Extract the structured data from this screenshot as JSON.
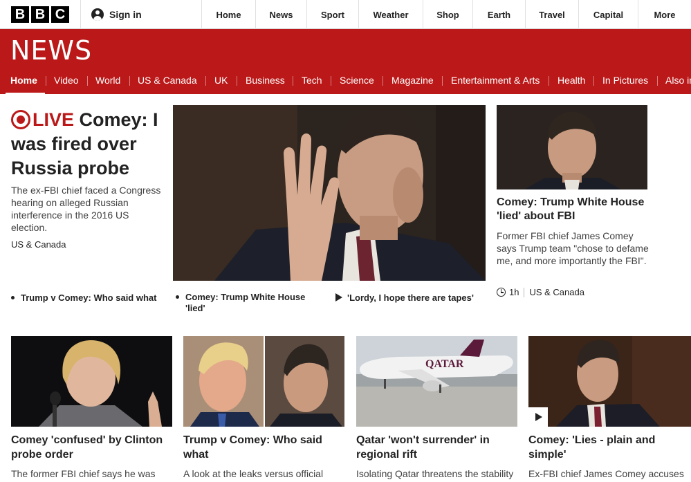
{
  "global_nav": {
    "logo_letters": [
      "B",
      "B",
      "C"
    ],
    "signin_label": "Sign in",
    "items": [
      "Home",
      "News",
      "Sport",
      "Weather",
      "Shop",
      "Earth",
      "Travel",
      "Capital",
      "More"
    ]
  },
  "news_banner": {
    "wordmark": "NEWS",
    "nav_items": [
      "Home",
      "Video",
      "World",
      "US & Canada",
      "UK",
      "Business",
      "Tech",
      "Science",
      "Magazine",
      "Entertainment & Arts",
      "Health",
      "In Pictures",
      "Also in"
    ],
    "active_item": "Home"
  },
  "lead_story": {
    "live_label": "LIVE",
    "headline": "Comey: I was fired over Russia probe",
    "summary": "The ex-FBI chief faced a Congress hearing on alleged Russian interference in the 2016 US election.",
    "tag": "US & Canada",
    "related": [
      {
        "label": "Trump v Comey: Who said what",
        "kind": "bullet"
      },
      {
        "label": "Comey: Trump White House 'lied'",
        "kind": "bullet"
      },
      {
        "label": "'Lordy, I hope there are tapes'",
        "kind": "video"
      }
    ]
  },
  "right_story": {
    "headline": "Comey: Trump White House 'lied' about FBI",
    "summary": "Former FBI chief James Comey says Trump team \"chose to defame me, and more importantly the FBI\".",
    "time": "1h",
    "tag": "US & Canada",
    "icon": "clock-icon"
  },
  "bottom_stories": [
    {
      "headline": "Comey 'confused' by Clinton probe order",
      "summary": "The former FBI chief says he was"
    },
    {
      "headline": "Trump v Comey: Who said what",
      "summary": "A look at the leaks versus official"
    },
    {
      "headline": "Qatar 'won't surrender' in regional rift",
      "summary": "Isolating Qatar threatens the stability"
    },
    {
      "headline": "Comey: 'Lies - plain and simple'",
      "summary": "Ex-FBI chief James Comey accuses"
    }
  ],
  "colors": {
    "brand_red": "#bb1919",
    "text": "#222222",
    "summary_text": "#404040"
  }
}
